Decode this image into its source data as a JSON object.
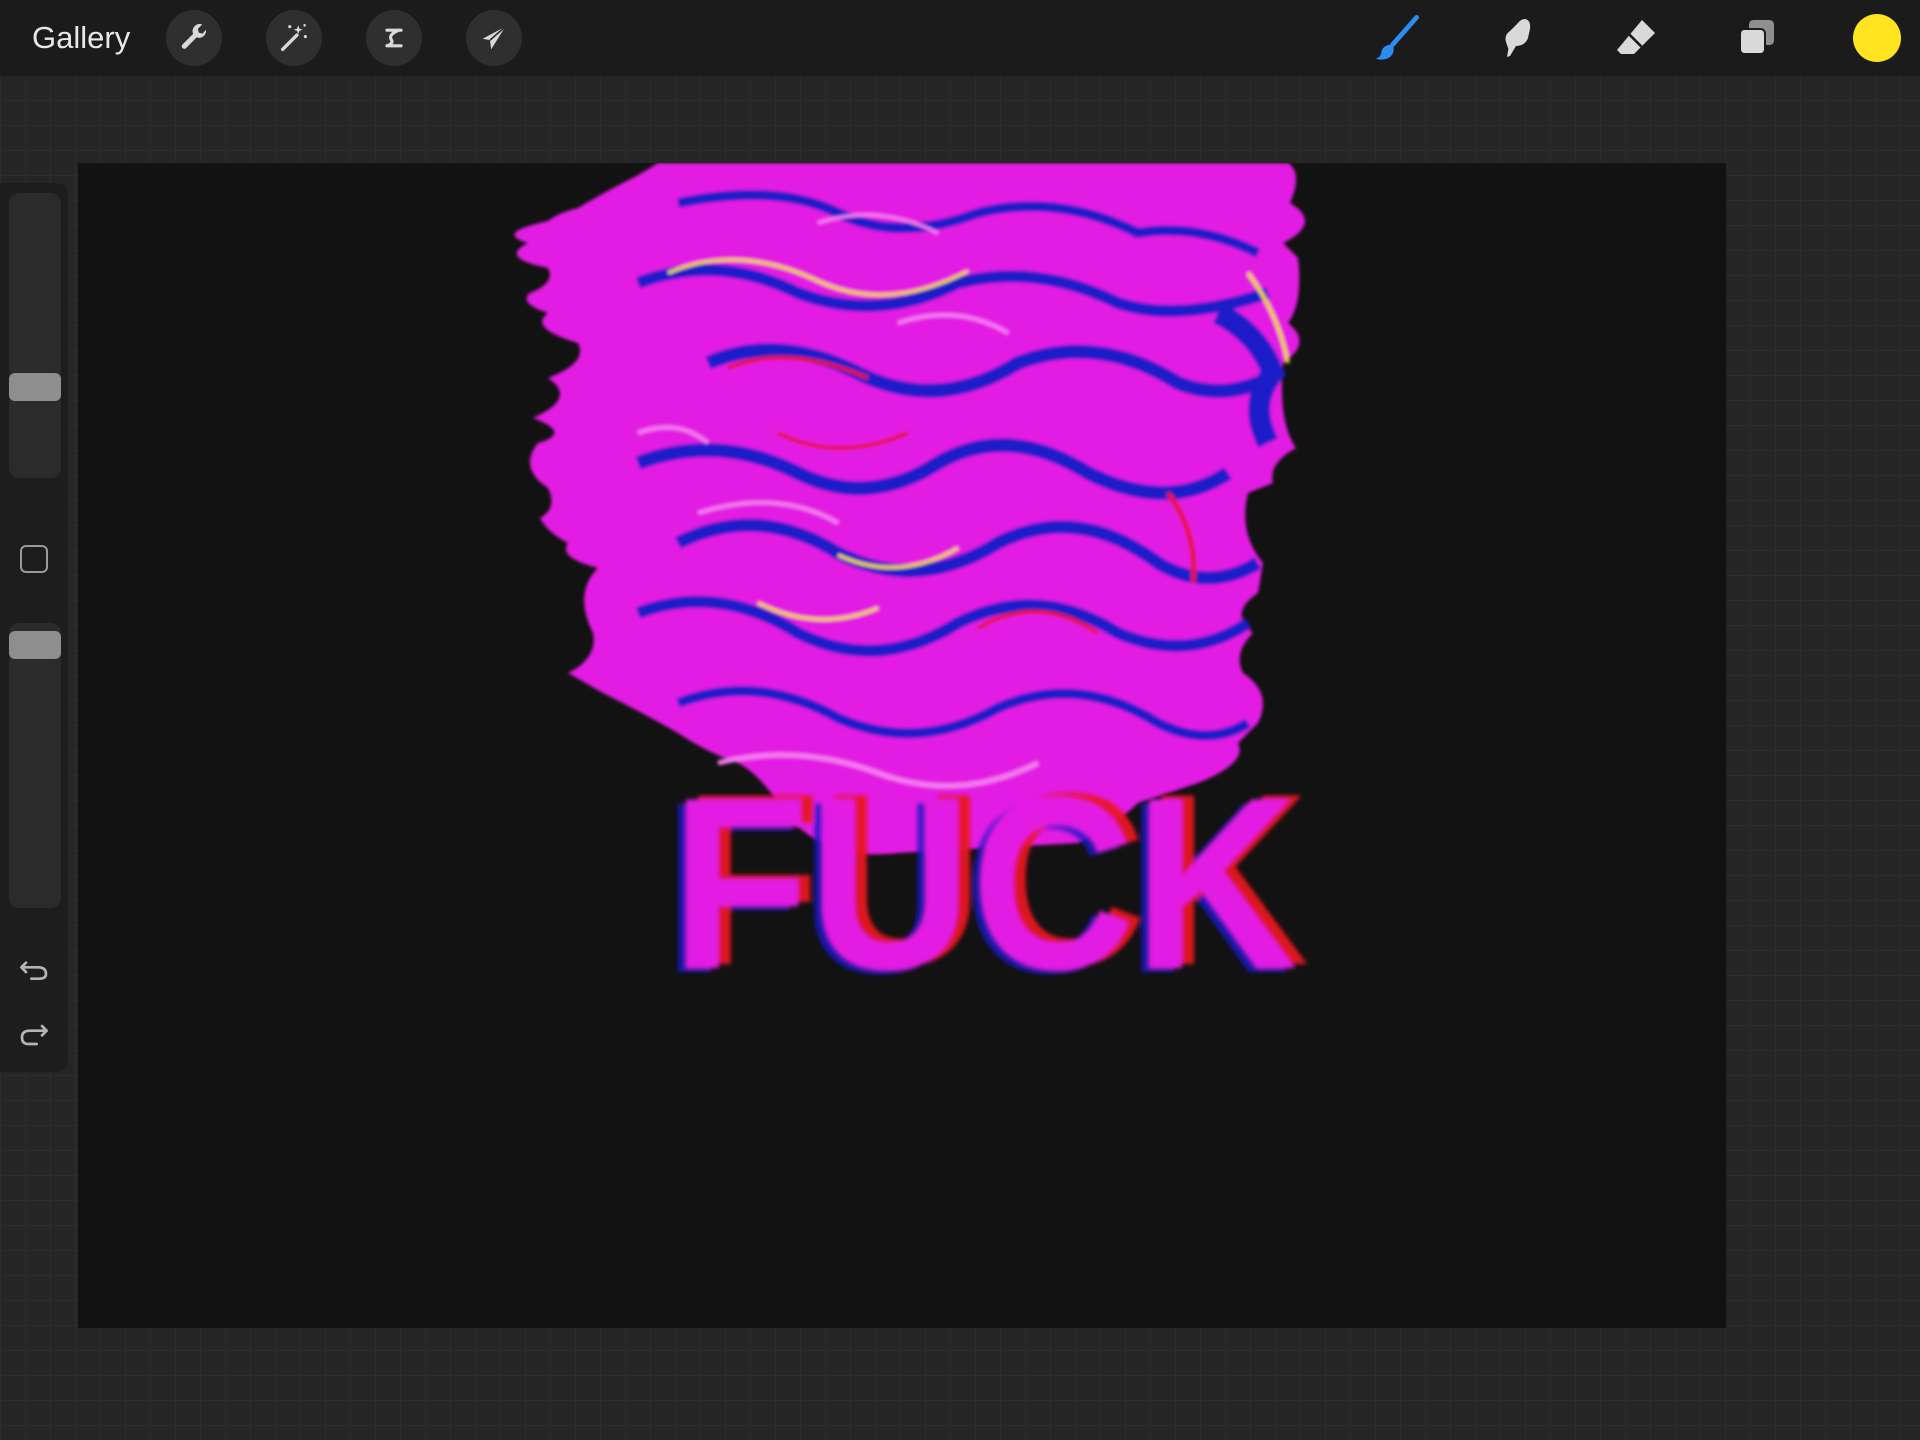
{
  "topbar": {
    "gallery_label": "Gallery",
    "tools_left": [
      {
        "name": "actions",
        "icon": "wrench-icon"
      },
      {
        "name": "adjustments",
        "icon": "magic-wand-icon"
      },
      {
        "name": "selection",
        "icon": "selection-s-icon"
      },
      {
        "name": "transform",
        "icon": "arrow-cursor-icon"
      }
    ],
    "tools_right": [
      {
        "name": "brush",
        "icon": "paintbrush-icon",
        "active": true
      },
      {
        "name": "smudge",
        "icon": "smudge-finger-icon",
        "active": false
      },
      {
        "name": "eraser",
        "icon": "eraser-icon",
        "active": false
      },
      {
        "name": "layers",
        "icon": "layers-icon",
        "active": false
      }
    ],
    "current_color": "#FFE51F"
  },
  "sidebar": {
    "brush_size_level": 0.3,
    "brush_opacity_level": 0.97,
    "modify_button_icon": "square-outline-icon",
    "undo_icon": "undo-arrow-icon",
    "redo_icon": "redo-arrow-icon"
  },
  "canvas": {
    "background_color": "#121212",
    "artwork_text": "FUCK",
    "artwork_colors": {
      "magenta": "#E81AE8",
      "pink": "#F57CF0",
      "blue": "#1B1AC9",
      "red": "#E8141E",
      "yellow": "#F2D10F"
    }
  }
}
